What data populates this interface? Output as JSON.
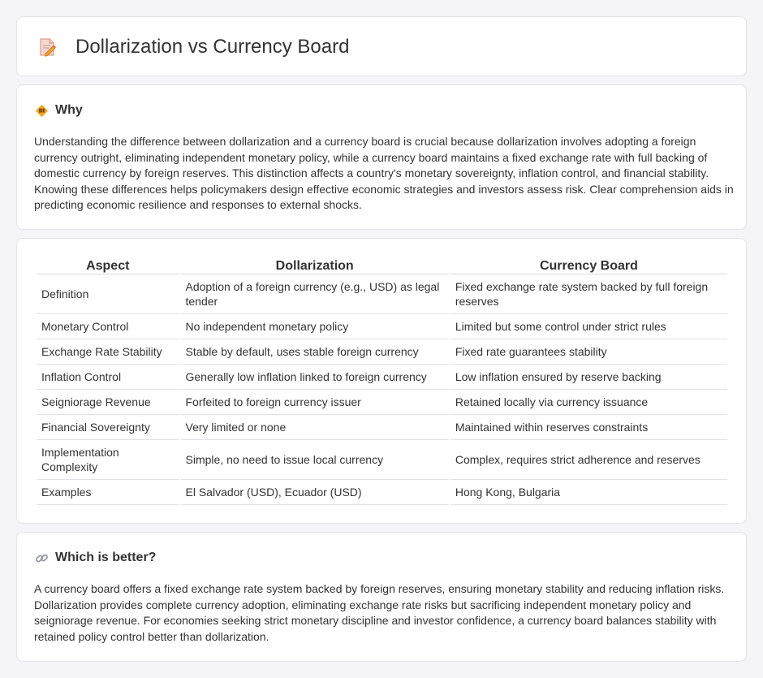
{
  "header": {
    "title": "Dollarization vs Currency Board",
    "icon": "document-pencil-icon"
  },
  "why": {
    "title": "Why",
    "icon": "warning-diamond-icon",
    "text": "Understanding the difference between dollarization and a currency board is crucial because dollarization involves adopting a foreign currency outright, eliminating independent monetary policy, while a currency board maintains a fixed exchange rate with full backing of domestic currency by foreign reserves. This distinction affects a country's monetary sovereignty, inflation control, and financial stability. Knowing these differences helps policymakers design effective economic strategies and investors assess risk. Clear comprehension aids in predicting economic resilience and responses to external shocks."
  },
  "table": {
    "headers": [
      "Aspect",
      "Dollarization",
      "Currency Board"
    ],
    "rows": [
      [
        "Definition",
        "Adoption of a foreign currency (e.g., USD) as legal tender",
        "Fixed exchange rate system backed by full foreign reserves"
      ],
      [
        "Monetary Control",
        "No independent monetary policy",
        "Limited but some control under strict rules"
      ],
      [
        "Exchange Rate Stability",
        "Stable by default, uses stable foreign currency",
        "Fixed rate guarantees stability"
      ],
      [
        "Inflation Control",
        "Generally low inflation linked to foreign currency",
        "Low inflation ensured by reserve backing"
      ],
      [
        "Seigniorage Revenue",
        "Forfeited to foreign currency issuer",
        "Retained locally via currency issuance"
      ],
      [
        "Financial Sovereignty",
        "Very limited or none",
        "Maintained within reserves constraints"
      ],
      [
        "Implementation Complexity",
        "Simple, no need to issue local currency",
        "Complex, requires strict adherence and reserves"
      ],
      [
        "Examples",
        "El Salvador (USD), Ecuador (USD)",
        "Hong Kong, Bulgaria"
      ]
    ]
  },
  "better": {
    "title": "Which is better?",
    "icon": "link-icon",
    "text": "A currency board offers a fixed exchange rate system backed by foreign reserves, ensuring monetary stability and reducing inflation risks. Dollarization provides complete currency adoption, eliminating exchange rate risks but sacrificing independent monetary policy and seigniorage revenue. For economies seeking strict monetary discipline and investor confidence, a currency board balances stability with retained policy control better than dollarization."
  },
  "colors": {
    "background": "#f5f5f7",
    "card": "#ffffff",
    "border": "#e3e3e8",
    "text": "#333333",
    "accent_orange": "#f0a030"
  }
}
